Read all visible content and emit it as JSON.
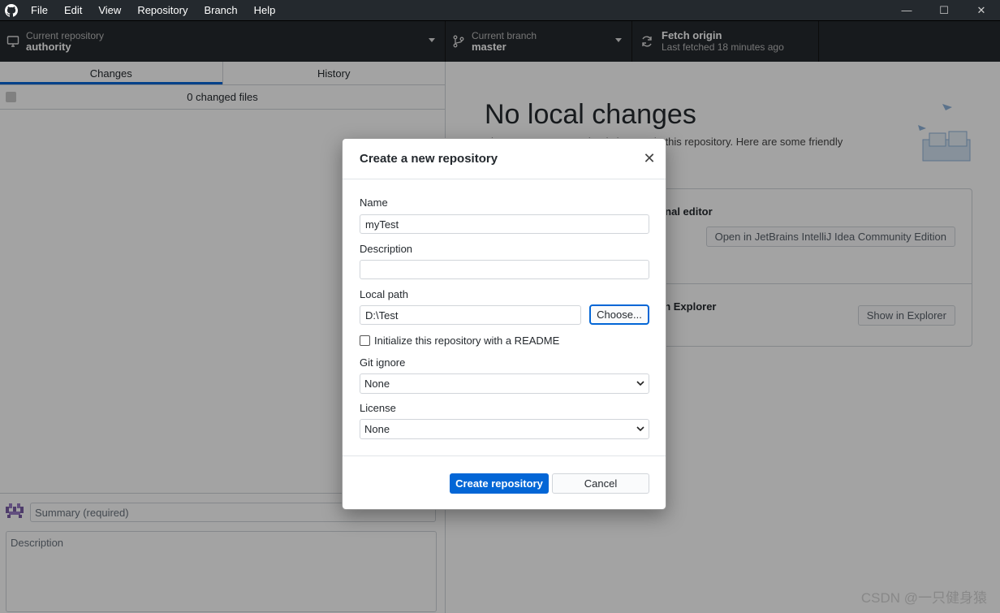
{
  "menu": [
    "File",
    "Edit",
    "View",
    "Repository",
    "Branch",
    "Help"
  ],
  "window_controls": {
    "minimize": "—",
    "maximize": "☐",
    "close": "✕"
  },
  "toolbar": {
    "repo": {
      "sub": "Current repository",
      "main": "authority",
      "icon": "monitor-icon"
    },
    "branch": {
      "sub": "Current branch",
      "main": "master",
      "icon": "branch-icon"
    },
    "fetch": {
      "main": "Fetch origin",
      "sub": "Last fetched 18 minutes ago",
      "icon": "sync-icon"
    }
  },
  "left_pane": {
    "tabs": [
      "Changes",
      "History"
    ],
    "changed_files": "0 changed files",
    "summary_placeholder": "Summary (required)",
    "description_placeholder": "Description"
  },
  "right_pane": {
    "title": "No local changes",
    "subtitle": "There are no uncommitted changes in this repository. Here are some friendly",
    "suggestions": [
      {
        "title": "Open the repository in your external editor",
        "button": "Open in JetBrains IntelliJ Idea Community Edition"
      },
      {
        "title": "View the files of your repository in Explorer",
        "button": "Show in Explorer"
      }
    ]
  },
  "dialog": {
    "title": "Create a new repository",
    "name_label": "Name",
    "name_value": "myTest",
    "description_label": "Description",
    "description_value": "",
    "local_path_label": "Local path",
    "local_path_value": "D:\\Test",
    "choose_button": "Choose...",
    "readme_label": "Initialize this repository with a README",
    "readme_checked": false,
    "gitignore_label": "Git ignore",
    "gitignore_value": "None",
    "license_label": "License",
    "license_value": "None",
    "create_button": "Create repository",
    "cancel_button": "Cancel"
  },
  "watermark": "CSDN @一只健身猿",
  "colors": {
    "accent": "#0366d6",
    "toolbar": "#24292e"
  }
}
